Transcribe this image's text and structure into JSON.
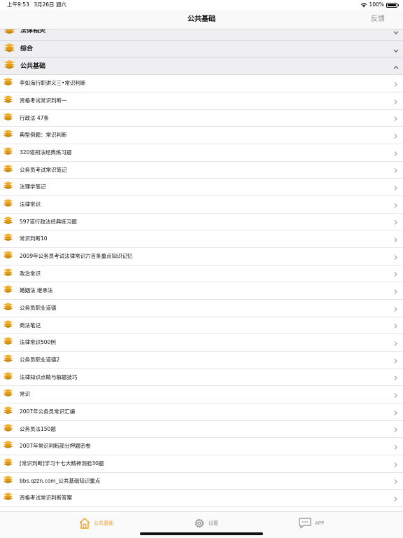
{
  "status_bar": {
    "time": "上午9:53",
    "date": "3月26日 週六",
    "battery": "100%",
    "battery_level": 1.0
  },
  "nav": {
    "title": "公共基础",
    "feedback": "反馈"
  },
  "sections": [
    {
      "label": "法律相关",
      "state": "collapsed"
    },
    {
      "label": "综合",
      "state": "collapsed"
    },
    {
      "label": "公共基础",
      "state": "expanded"
    }
  ],
  "items": [
    "李如海行职讲义三•常识判断",
    "资格考试常识判断一",
    "行政法 47条",
    "典型例题：常识判断",
    "320道刑法经典练习题",
    "公务员考试常识笔记",
    "法理学笔记",
    "法律常识",
    "597道行政法经典练习题",
    "常识判断10",
    "2009年公务员考试法律常识六百条重点知识记忆",
    "政治常识",
    "婚姻法 继承法",
    "公务员职业道德",
    "商法笔记",
    "法律常识500例",
    "公务员职业道德2",
    "法律知识点睛与解题技巧",
    "常识",
    "2007年公务员常识汇编",
    "公务员法150题",
    "2007年常识判断部分押题密卷",
    "[常识判断]学习十七大精神测验30题",
    "bbs.qzzn.com_公共基础知识重点",
    "资格考试常识判断答案"
  ],
  "tabs": [
    {
      "label": "公共基础",
      "icon": "home-icon",
      "active": true
    },
    {
      "label": "设置",
      "icon": "gear-icon",
      "active": false
    },
    {
      "label": "APP",
      "icon": "chat-bubble-icon",
      "active": false
    }
  ],
  "colors": {
    "accent": "#f0a020",
    "icon_gold": "#e8a317",
    "inactive": "#8e8e93"
  }
}
